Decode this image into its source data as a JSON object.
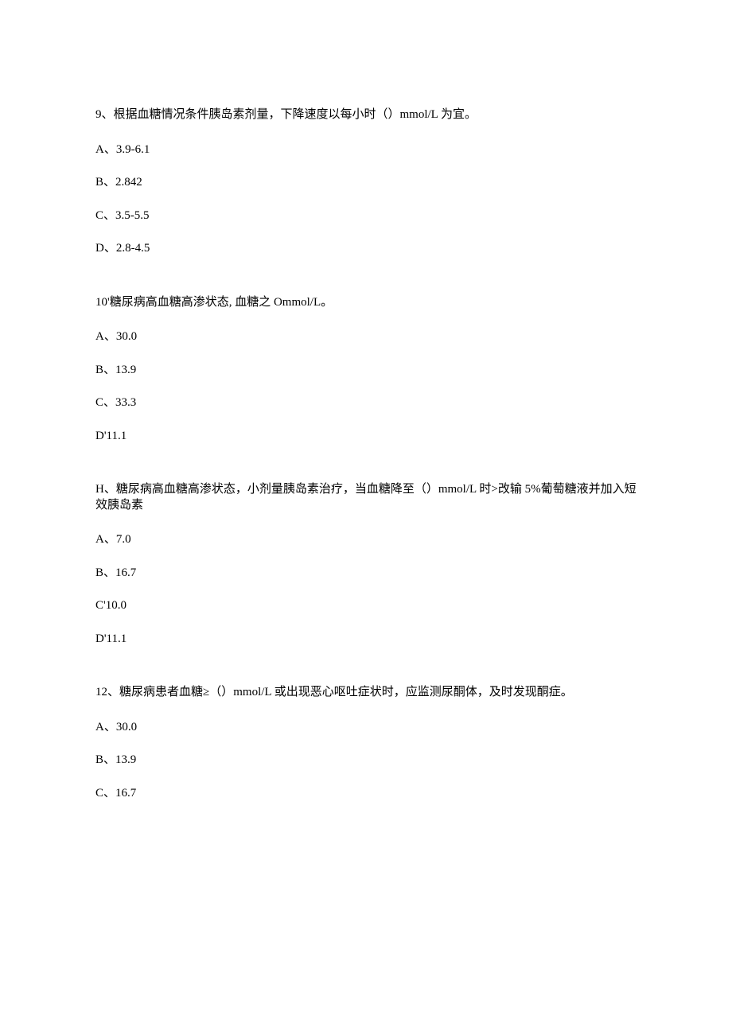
{
  "questions": [
    {
      "prompt": "9、根据血糖情况条件胰岛素剂量，下降速度以每小时（）mmol/L 为宜。",
      "options": [
        "A、3.9-6.1",
        "B、2.842",
        "C、3.5-5.5",
        "D、2.8-4.5"
      ]
    },
    {
      "prompt": "10'糖尿病高血糖高渗状态, 血糖之 Ommol/L。",
      "options": [
        "A、30.0",
        "B、13.9",
        "C、33.3",
        "D'11.1"
      ]
    },
    {
      "prompt": "H、糖尿病高血糖高渗状态，小剂量胰岛素治疗，当血糖降至（）mmol/L 时>改输 5%葡萄糖液并加入短效胰岛素",
      "options": [
        "A、7.0",
        "B、16.7",
        "C'10.0",
        "D'11.1"
      ]
    },
    {
      "prompt": "12、糖尿病患者血糖≥（）mmol/L 或出现恶心呕吐症状时，应监测尿酮体，及时发现酮症。",
      "options": [
        "A、30.0",
        "B、13.9",
        "C、16.7"
      ]
    }
  ]
}
